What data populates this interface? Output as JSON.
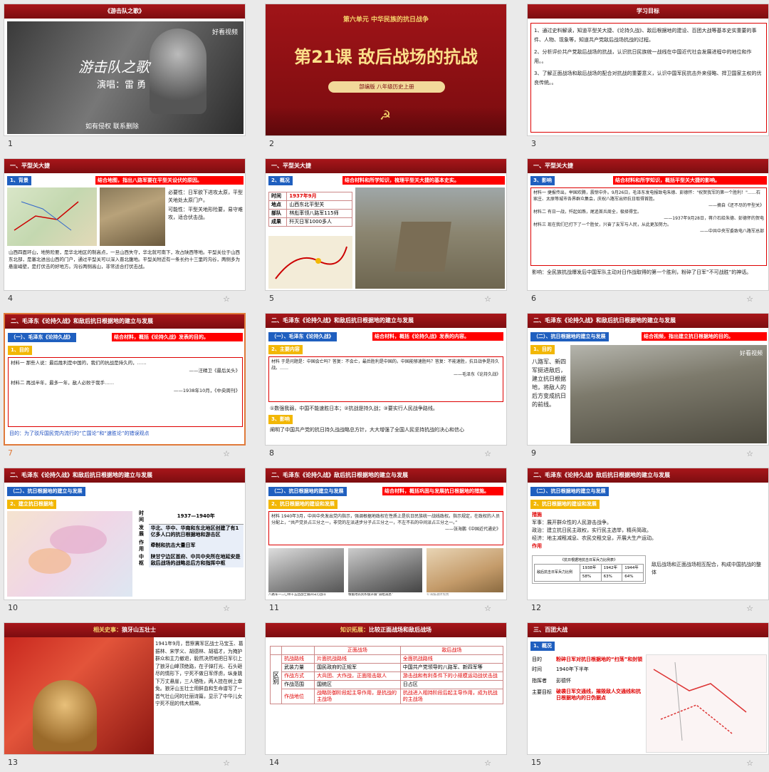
{
  "slides": [
    {
      "num": "1",
      "title": "《游击队之歌》",
      "video_title": "游击队之歌",
      "singer": "演唱：雷  勇",
      "logo": "好看视频",
      "footer": "如有侵权 联系删除"
    },
    {
      "num": "2",
      "unit": "第六单元   中华民族的抗日战争",
      "title": "第21课 敌后战场的抗战",
      "subtitle": "部编版   八年级历史上册"
    },
    {
      "num": "3",
      "title": "学习目标",
      "goal1": "1、通过史料解读，知道平型关大捷、《论持久战》、敌后根据地的建设、百团大战等基本史实重要的事件、人物、现象等，知道共产党敌后战场抗战的过程。",
      "goal2": "2、分析评价共产党敌后战场的抗战，认识抗日民族统一战线在中国近代社会发展进程中的地位和作用。。",
      "goal3": "3、了解正面战场和敌后战场的配合对抗战的重要意义，认识中国军民抗击外来侵略、捍卫国家主权的优良传统。。"
    },
    {
      "num": "4",
      "header": "一、平型关大捷",
      "tag": "1、背景",
      "task": "结合地图，指出八路军要在平型关设伏的原因。",
      "note1": "必要性：日军欲下进攻太原，平型关地处太原门户。",
      "note2": "可能性：平型关地形险要，易守难攻，适合伏击战。",
      "body": "山西四面环山，地势险要，是华北地区的制高点，一旦山西失守，华北就可南下，攻占陕西等地。平型关位于山西东北部，是塞北进出山西的门户，通过平型关可以深入晋北腹地。平型关附近有一条长约十三里的沟谷，两侧多为悬崖峭壁，是打伏击的好地方。沟谷两侧高山，非常适合打伏击战。"
    },
    {
      "num": "5",
      "header": "一、平型关大捷",
      "tag": "2、概况",
      "task": "结合材料和所学知识，梳理平型关大捷的基本史实。",
      "rows": [
        {
          "k": "时间",
          "v": "1937年9月"
        },
        {
          "k": "地点",
          "v": "山西东北平型关"
        },
        {
          "k": "部队",
          "v": "林彪率领八路军115师"
        },
        {
          "k": "成果",
          "v": "歼灭日军1000多人"
        }
      ]
    },
    {
      "num": "6",
      "header": "一、平型关大捷",
      "tag": "3、影响",
      "task": "结合材料和所学知识，概括平型关大捷的影响。",
      "m1": "材料一  捷报传出，举国欢腾，震惊中外。9月26日，毛泽东发电报致电朱德、彭德怀：\"祝贺我军的第一个胜利！\"……石家庄、太原等城市各界群众集会，庆祝八路军出师抗日取得首胜。",
      "src1": "——摘自《还不尽的平型关》",
      "m2": "材料二  有日一战，歼起如燕，尾追首兵周全，极择得宝。",
      "src2": "——1937年9月28日，蒋介石给朱德、彭德怀的贺电",
      "m3": "材料三  现在我们已打下了一个胜仗，兴奋了友军与人民，从此更加努力。",
      "src3": "——中共中央军委致电八路军总部",
      "effect": "影响：全民族抗战爆发后中国军队主动对日作战取得的第一个胜利，粉碎了日军“不可战胜”的神话。"
    },
    {
      "num": "7",
      "header": "二、毛泽东《论持久战》和敌后抗日根据地的建立与发展",
      "tag": "（一）、毛泽东《论持久战》",
      "task": "结合材料，概括《论持久战》发表的目的。",
      "tag2": "1、目的",
      "m1": "材料一  那些人说：最后胜利是中国的，我们的抗战是持久的，……",
      "src1": "——汪精卫《最后关头》",
      "m2": "材料二  再战半年，最多一年，敌人必败于我手……",
      "src2": "——1938年10月，《中央周刊》",
      "purpose": "目的：为了驳斥国民党内流行的“亡国论”和“速胜论”的错误观点"
    },
    {
      "num": "8",
      "header": "二、毛泽东《论持久战》和敌后抗日根据地的建立与发展",
      "tag": "（一）、毛泽东《论持久战》",
      "task": "结合材料，概括《论持久战》发表的内容。",
      "tag2": "2、主要内容",
      "m": "材料  于是问题是：中国会亡吗？答复：不会亡，最后胜利是中国的。中国能够速胜吗？答复：不能速胜，抗日战争是持久战。……",
      "src": "——毛泽东《论持久战》",
      "content": "①数强我弱，中国不能速胜日本；②抗战是持久战；③要实行人民战争路线。",
      "tag3": "3、影响",
      "effect": "阐明了中国共产党的抗日持久战战略总方针，大大增强了全国人民坚持抗战的决心和信心"
    },
    {
      "num": "9",
      "header": "二、毛泽东《论持久战》和敌后抗日根据地的建立与发展",
      "tag": "（二）、抗日根据地的建立与发展",
      "task": "结合视频，指出建立抗日根据地的目的。",
      "tag2": "1、目的",
      "purpose": "八路军、新四军挺进敌后，建立抗日根据地，将敌人的后方变成抗日的前线。",
      "logo": "好看视频"
    },
    {
      "num": "10",
      "header": "二、毛泽东《论持久战》和敌后抗日根据地的建立与发展",
      "tag": "（二）、抗日根据地的建立与发展",
      "tag2": "2、建立抗日根据地",
      "rows": [
        {
          "k": "时间",
          "v": "1937—1940年"
        },
        {
          "k": "发展",
          "v": "华北、华中、华南和东北地区创建了有1亿多人口的抗日根据地和游击区"
        },
        {
          "k": "作用",
          "v": "牵制和抗击大量日军"
        },
        {
          "k": "中枢",
          "v": "陕甘宁边区首府、中共中央所在地延安是敌后战场的战略总后方和指挥中枢"
        }
      ]
    },
    {
      "num": "11",
      "header": "二、毛泽东《论持久战》敌后抗日根据地的建立与发展",
      "tag": "（二）、抗日根据地的建立与发展",
      "task": "结合材料，概括巩固与发展抗日根据地的措施。",
      "tag2": "2、抗日根据地的建设和发展",
      "m": "材料  1940年3月，中共中央发出党内指示，强调根据地政权在性质上是抗日民族统一战线政权。指示规定，在政权的人员分配上，“共产党员占三分之一，非党的左派进步分子占三分之一，不左不右的中间派占三分之一。”",
      "src": "——张海鹏《中国近代通史》",
      "cap1": "八路军一二〇师十五团战士展开白刃战斗",
      "cap2": "根据地农民积极开展“减租减息”",
      "cap3": "©海报通体免费"
    },
    {
      "num": "12",
      "header": "二、毛泽东《论持久战》敌后抗日根据地的建立与发展",
      "tag": "（二）、抗日根据地的建立与发展",
      "tag2": "2、抗日根据地的建设和发展",
      "measures": "措施",
      "m_army": "军事：展开群众性的人民游击战争。",
      "m_pol": "政治：建立抗日民主政权，实行民主选举，精兵简政。",
      "m_eco": "经济：地主减租减息、农民交租交息，开展大生产运动。",
      "role": "作用",
      "table_title": "《抗日根据地抗击日军兵力比例表》",
      "t_head": "敌后抗击日军兵力比例",
      "years": [
        "1938年",
        "1942年",
        "1944年"
      ],
      "pcts": [
        "58%",
        "63%",
        "64%"
      ],
      "summary": "敌后战场和正面战场相互配合，构成中国抗战的整体"
    },
    {
      "num": "13",
      "header_a": "相关史事：",
      "header_b": "狼牙山五壮士",
      "body": "1941年9月，晋察冀军区战士马宝玉、葛振林、宋学义、胡德林、胡福才，为掩护群众和主力撤退，毅然决然地把日军引上了狼牙山峰顶绝路，在子弹打光、石头砸尽的情形下，宁死不做日军俘虏，纵身跳下万丈悬崖，三人牺牲，两人挂在树上幸免。狼牙山五壮士用鲜血和生命谱写了一首气壮山河的壮丽诗篇，显示了中华儿女宁死不屈的伟大精神。"
    },
    {
      "num": "14",
      "header_a": "知识拓展：",
      "header_b": "比较正面战场和敌后战场",
      "col1": "正面战场",
      "col2": "敌后战场",
      "side": "区别",
      "rows": [
        {
          "k": "抗战路线",
          "a": "片面抗战路线",
          "b": "全面抗战路线"
        },
        {
          "k": "武装力量",
          "a": "国民政府的正规军",
          "b": "中国共产党领导的八路军、新四军等"
        },
        {
          "k": "作战方式",
          "a": "大兵团、大作战，正面阻击敌人",
          "b": "游击战和有利条件下的小规模运动战伏击战"
        },
        {
          "k": "作战范围",
          "a": "国统区",
          "b": "日占区"
        },
        {
          "k": "作战地位",
          "a": "战略防御阶段起主导作用，是抗战的主战场",
          "b": "抗战进入相持阶段后起主导作用，成为抗战的主战场"
        }
      ]
    },
    {
      "num": "15",
      "header": "三、百团大战",
      "tag": "1、概况",
      "rows": [
        {
          "k": "目的",
          "v": "粉碎日军对抗日根据地的“扫荡”和封锁"
        },
        {
          "k": "时间",
          "v": "1940年下半年"
        },
        {
          "k": "指挥者",
          "v": "彭德怀"
        },
        {
          "k": "主要目标",
          "v": "破袭日军交通线，摧毁敌人交通线和抗日根据地内的日伪据点"
        }
      ]
    }
  ],
  "colors": {
    "accent": "#a8161a",
    "red": "#e60000",
    "blue": "#1f5fbf",
    "yellow": "#f2b705",
    "selected": "#e07a3a"
  },
  "selected_slide": "7"
}
